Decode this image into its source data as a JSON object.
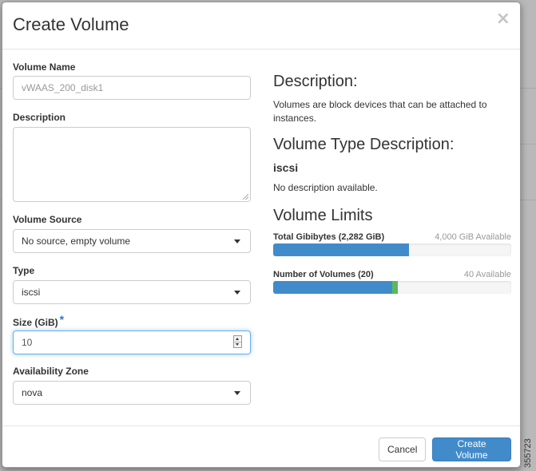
{
  "modal": {
    "title": "Create Volume",
    "close_glyph": "×"
  },
  "form": {
    "volume_name": {
      "label": "Volume Name",
      "value": "",
      "placeholder": "vWAAS_200_disk1"
    },
    "description": {
      "label": "Description",
      "value": ""
    },
    "volume_source": {
      "label": "Volume Source",
      "selected": "No source, empty volume"
    },
    "type": {
      "label": "Type",
      "selected": "iscsi"
    },
    "size": {
      "label": "Size (GiB)",
      "required_mark": "*",
      "value": "10"
    },
    "availability_zone": {
      "label": "Availability Zone",
      "selected": "nova"
    }
  },
  "info": {
    "description_heading": "Description:",
    "description_text": "Volumes are block devices that can be attached to instances.",
    "type_heading": "Volume Type Description:",
    "type_name": "iscsi",
    "type_text": "No description available.",
    "limits_heading": "Volume Limits",
    "gibibytes": {
      "label": "Total Gibibytes (2,282 GiB)",
      "available": "4,000 GiB Available",
      "used": 2282,
      "max": 4000,
      "pending": 0
    },
    "volumes": {
      "label": "Number of Volumes (20)",
      "available": "40 Available",
      "used": 20,
      "max": 40,
      "pending": 1
    }
  },
  "footer": {
    "cancel_label": "Cancel",
    "submit_label": "Create Volume"
  },
  "side_number": "355723",
  "colors": {
    "primary": "#428bca",
    "progress_new": "#5cb85c",
    "required": "#1f7bd1"
  },
  "icons": {
    "close": "close-icon",
    "dropdown": "chevron-down-icon",
    "spinner": "spinner-icon"
  }
}
